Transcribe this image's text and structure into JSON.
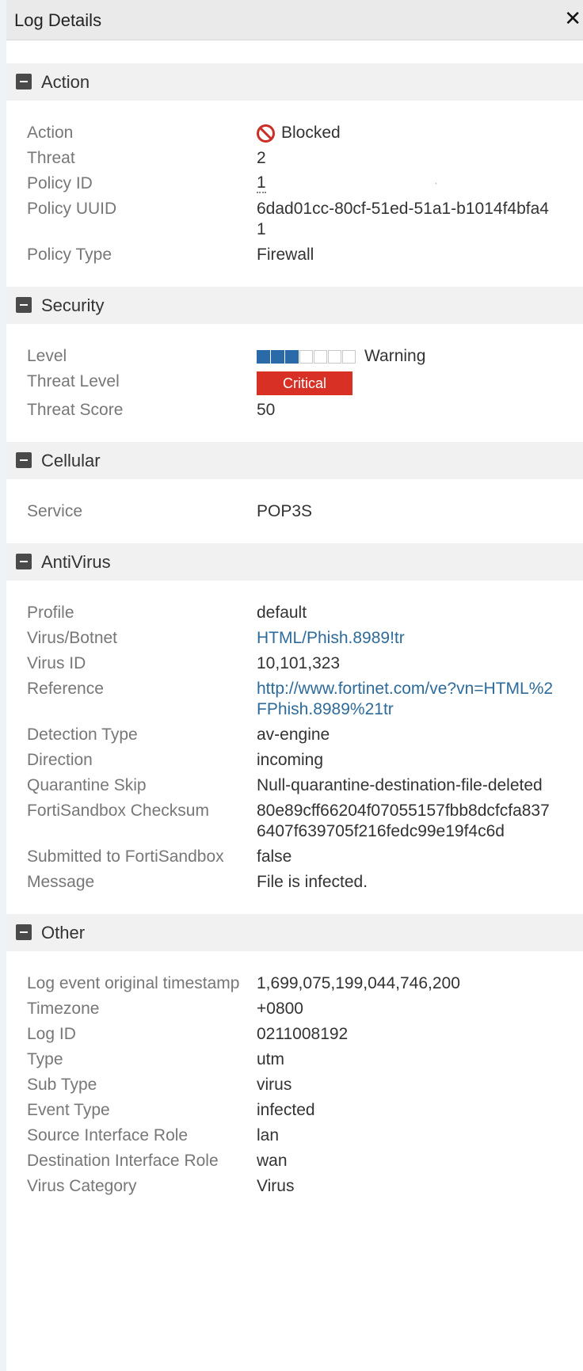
{
  "header": {
    "title": "Log Details",
    "close_icon": "close-icon"
  },
  "colors": {
    "critical_badge": "#d93025",
    "blocked_icon": "#cc2e25",
    "link": "#2f6b9a",
    "level_on": "#2a6aa8"
  },
  "action": {
    "title": "Action",
    "action_label": "Action",
    "action_value": "Blocked",
    "action_icon": "blocked-icon",
    "threat_label": "Threat",
    "threat_value": "2",
    "policy_id_label": "Policy ID",
    "policy_id_value": "1",
    "policy_uuid_label": "Policy UUID",
    "policy_uuid_value": "6dad01cc-80cf-51ed-51a1-b1014f4bfa41",
    "policy_type_label": "Policy Type",
    "policy_type_value": "Firewall"
  },
  "security": {
    "title": "Security",
    "level_label": "Level",
    "level_value": "Warning",
    "level_filled_of_7": 3,
    "threat_level_label": "Threat Level",
    "threat_level_value": "Critical",
    "threat_score_label": "Threat Score",
    "threat_score_value": "50"
  },
  "cellular": {
    "title": "Cellular",
    "service_label": "Service",
    "service_value": "POP3S"
  },
  "antivirus": {
    "title": "AntiVirus",
    "profile_label": "Profile",
    "profile_value": "default",
    "virus_botnet_label": "Virus/Botnet",
    "virus_botnet_value": "HTML/Phish.8989!tr",
    "virus_id_label": "Virus ID",
    "virus_id_value": "10,101,323",
    "reference_label": "Reference",
    "reference_value": "http://www.fortinet.com/ve?vn=HTML%2FPhish.8989%21tr",
    "detection_type_label": "Detection Type",
    "detection_type_value": "av-engine",
    "direction_label": "Direction",
    "direction_value": "incoming",
    "quarantine_skip_label": "Quarantine Skip",
    "quarantine_skip_value": "Null-quarantine-destination-file-deleted",
    "checksum_label": "FortiSandbox Checksum",
    "checksum_value": "80e89cff66204f07055157fbb8dcfcfa8376407f639705f216fedc99e19f4c6d",
    "submitted_label": "Submitted to FortiSandbox",
    "submitted_value": "false",
    "message_label": "Message",
    "message_value": "File is infected."
  },
  "other": {
    "title": "Other",
    "timestamp_label": "Log event original timestamp",
    "timestamp_value": "1,699,075,199,044,746,200",
    "timezone_label": "Timezone",
    "timezone_value": "+0800",
    "log_id_label": "Log ID",
    "log_id_value": "0211008192",
    "type_label": "Type",
    "type_value": "utm",
    "sub_type_label": "Sub Type",
    "sub_type_value": "virus",
    "event_type_label": "Event Type",
    "event_type_value": "infected",
    "src_role_label": "Source Interface Role",
    "src_role_value": "lan",
    "dst_role_label": "Destination Interface Role",
    "dst_role_value": "wan",
    "virus_category_label": "Virus Category",
    "virus_category_value": "Virus"
  }
}
